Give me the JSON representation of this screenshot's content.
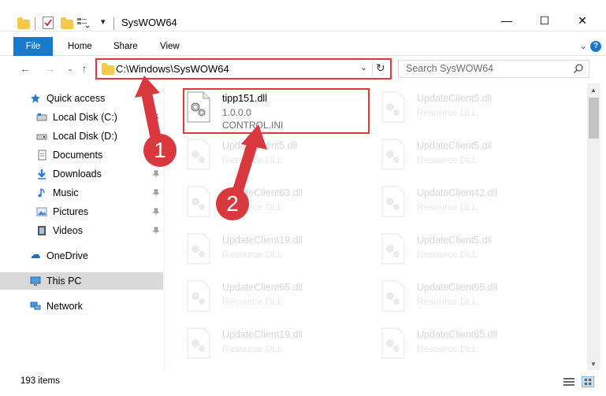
{
  "window": {
    "title": "SysWOW64",
    "controls": {
      "minimize": "—",
      "maximize": "☐",
      "close": "✕"
    }
  },
  "ribbon": {
    "tabs": [
      "File",
      "Home",
      "Share",
      "View"
    ],
    "expand_icon": "chevron-down-icon",
    "help_icon": "?"
  },
  "address": {
    "path": "C:\\Windows\\SysWOW64",
    "dropdown_icon": "⌄",
    "refresh_icon": "↻"
  },
  "search": {
    "placeholder": "Search SysWOW64"
  },
  "sidebar": {
    "quick_access": "Quick access",
    "items": [
      {
        "label": "Local Disk (C:)",
        "icon": "drive-icon",
        "pinned": true
      },
      {
        "label": "Local Disk (D:)",
        "icon": "drive-icon",
        "pinned": false
      },
      {
        "label": "Documents",
        "icon": "documents-icon",
        "pinned": true
      },
      {
        "label": "Downloads",
        "icon": "downloads-icon",
        "pinned": true
      },
      {
        "label": "Music",
        "icon": "music-icon",
        "pinned": true
      },
      {
        "label": "Pictures",
        "icon": "pictures-icon",
        "pinned": true
      },
      {
        "label": "Videos",
        "icon": "videos-icon",
        "pinned": true
      }
    ],
    "onedrive": "OneDrive",
    "this_pc": "This PC",
    "network": "Network"
  },
  "files": {
    "highlighted": {
      "name": "tipp151.dll",
      "version": "1.0.0.0",
      "description": "CONTROL.INI"
    },
    "left_column": [
      {
        "name": "UpdateClient5.dll",
        "description": "Resource DLL"
      },
      {
        "name": "UpdateClient63.dll",
        "description": "Resource DLL"
      },
      {
        "name": "UpdateClient19.dll",
        "description": "Resource DLL"
      },
      {
        "name": "UpdateClient65.dll",
        "description": "Resource DLL"
      },
      {
        "name": "UpdateClient19.dll",
        "description": "Resource DLL"
      }
    ],
    "right_column": [
      {
        "name": "UpdateClient5.dll",
        "description": "Resource DLL"
      },
      {
        "name": "UpdateClient5.dll",
        "description": "Resource DLL"
      },
      {
        "name": "UpdateClient42.dll",
        "description": "Resource DLL"
      },
      {
        "name": "UpdateClient5.dll",
        "description": "Resource DLL"
      },
      {
        "name": "UpdateClient65.dll",
        "description": "Resource DLL"
      },
      {
        "name": "UpdateClient65.dll",
        "description": "Resource DLL"
      }
    ]
  },
  "status": {
    "items_count": "193 items"
  },
  "annotations": {
    "step1": "1",
    "step2": "2",
    "color": "#d9393e"
  },
  "colors": {
    "accent": "#1979ca",
    "highlight_border": "#e0393e",
    "folder": "#f6c94a"
  }
}
